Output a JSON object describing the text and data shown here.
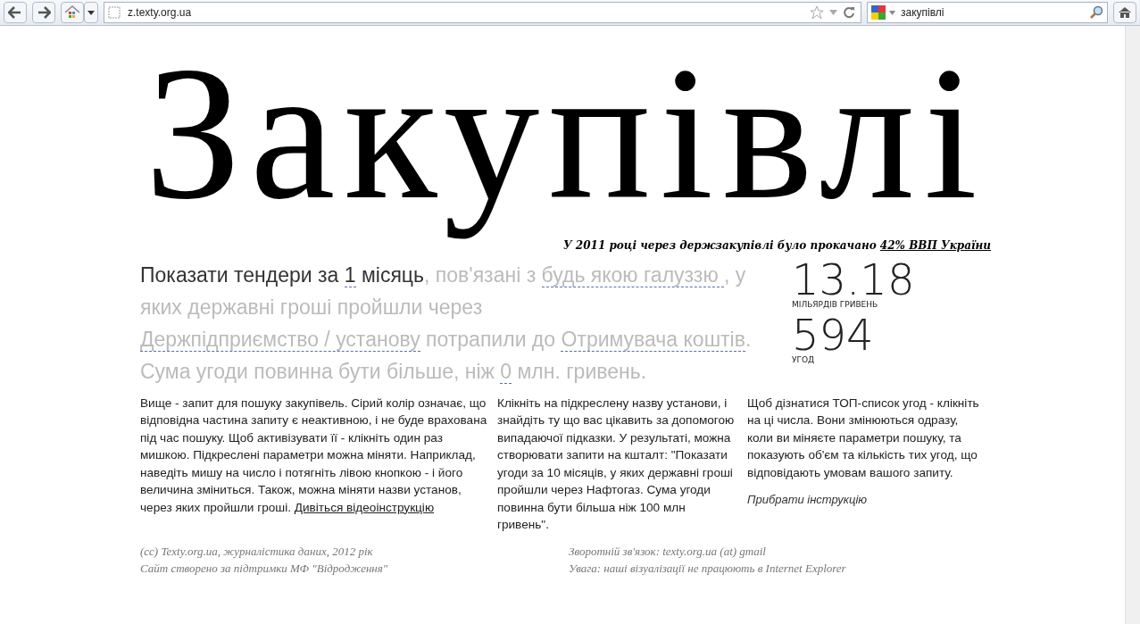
{
  "browser": {
    "url": "z.texty.org.ua",
    "search": "закупівлі"
  },
  "title": "Закупівлі",
  "subtitle": {
    "text": "У 2011 році через держзакупівлі було прокачано ",
    "link": "42% ВВП України"
  },
  "query": [
    {
      "text": "Показати тендери за ",
      "active": true,
      "param": false
    },
    {
      "text": "1",
      "active": true,
      "param": true
    },
    {
      "text": " місяць",
      "active": true,
      "param": false
    },
    {
      "text": ", пов'язані з ",
      "active": false,
      "param": false
    },
    {
      "text": "будь якою галуззю ",
      "active": false,
      "param": true
    },
    {
      "text": ", у яких державні гроші пройшли через ",
      "active": false,
      "param": false
    },
    {
      "text": "Держпідприємство / установу",
      "active": false,
      "param": true
    },
    {
      "text": " потрапили до ",
      "active": false,
      "param": false
    },
    {
      "text": "Отримувача коштів",
      "active": false,
      "param": true
    },
    {
      "text": ". Сума угоди повинна бути більше, ніж ",
      "active": false,
      "param": false
    },
    {
      "text": "0",
      "active": false,
      "param": true
    },
    {
      "text": " млн. гривень.",
      "active": false,
      "param": false
    }
  ],
  "stats": [
    {
      "value": "13.18",
      "label": "МІЛЬЯРДІВ ГРИВЕНЬ"
    },
    {
      "value": "594",
      "label": "УГОД"
    }
  ],
  "instructions": [
    {
      "text": "Вище - запит для пошуку закупівель. Сірий колір означає, що відповідна частина запиту є неактивною, і не буде врахована під час пошуку. Щоб активізувати її - клікніть один раз мишкою. Підкреслені параметри можна міняти. Наприклад, наведіть мишу на число і потягніть лівою кнопкою - і його величина зміниться. Також, можна міняти назви установ, через яких пройшли гроші. ",
      "link": "Дивіться відеоінструкцію"
    },
    {
      "text": "Клікніть на підкреслену назву установи, і знайдіть ту що вас цікавить за допомогою випадаючої підказки. У результаті, можна створювати запити на кшталт: \"Показати угоди за 10 місяців, у яких державні гроші пройшли через Нафтогаз. Сума угоди повинна бути більша ніж 100 млн гривень\"."
    },
    {
      "text": "Щоб дізнатися ТОП-список угод - клікніть на ці числа. Вони змінюються одразу, коли ви міняєте параметри пошуку, та показують об'єм та кількість тих угод, що відповідають умовам вашого запиту.",
      "link": "Прибрати інструкцію"
    }
  ],
  "footer": [
    [
      "(cc) Texty.org.ua, журналістика даних, 2012 рік",
      "Сайт створено за підтримки МФ \"Відродження\""
    ],
    [
      "Зворотній зв'язок: texty.org.ua (at) gmail",
      "Увага: наші візуалізації не працюють в Internet Explorer"
    ]
  ]
}
